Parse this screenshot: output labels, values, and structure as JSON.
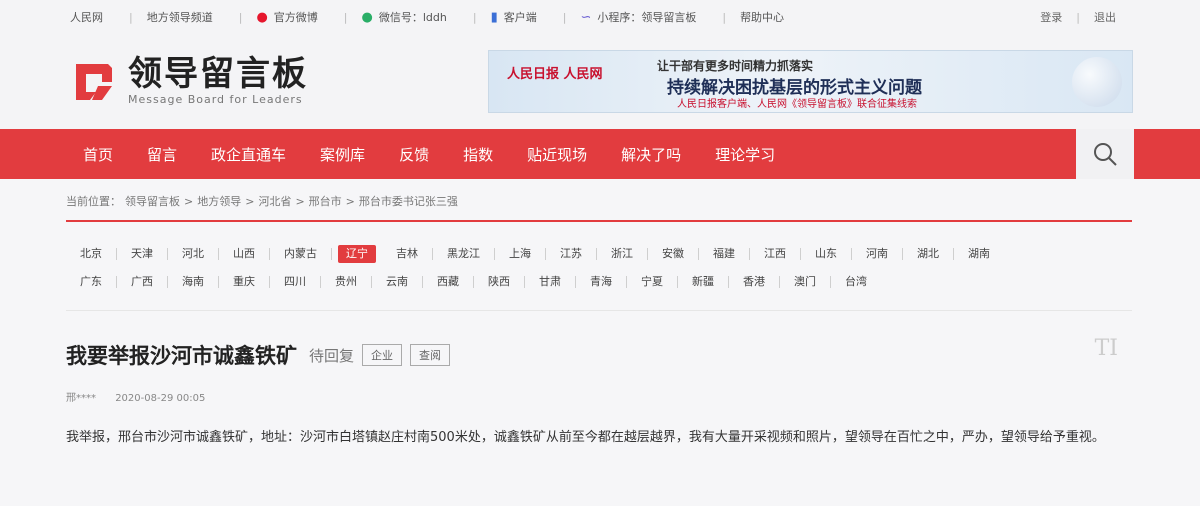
{
  "topbar": {
    "links": [
      {
        "label": "人民网",
        "icon": ""
      },
      {
        "label": "地方领导频道",
        "icon": ""
      },
      {
        "label": "官方微博",
        "icon": "weibo-icon"
      },
      {
        "label": "微信号：lddh",
        "icon": "wechat-icon"
      },
      {
        "label": "客户端",
        "icon": "phone-icon"
      },
      {
        "label": "小程序：领导留言板",
        "icon": "miniprogram-icon"
      },
      {
        "label": "帮助中心",
        "icon": ""
      }
    ],
    "login": "登录",
    "logout": "退出"
  },
  "logo": {
    "cn": "领导留言板",
    "en": "Message Board for Leaders"
  },
  "banner": {
    "publisher": "人民日报 人民网",
    "line1": "让干部有更多时间精力抓落实",
    "line2": "持续解决困扰基层的形式主义问题",
    "line3": "人民日报客户端、人民网《领导留言板》联合征集线索"
  },
  "nav": [
    "首页",
    "留言",
    "政企直通车",
    "案例库",
    "反馈",
    "指数",
    "贴近现场",
    "解决了吗",
    "理论学习"
  ],
  "breadcrumb": {
    "prefix": "当前位置：",
    "items": [
      "领导留言板",
      "地方领导",
      "河北省",
      "邢台市",
      "邢台市委书记张三强"
    ]
  },
  "regions": {
    "row1": [
      "北京",
      "天津",
      "河北",
      "山西",
      "内蒙古",
      "辽宁",
      "吉林",
      "黑龙江",
      "上海",
      "江苏",
      "浙江",
      "安徽",
      "福建",
      "江西",
      "山东",
      "河南",
      "湖北",
      "湖南"
    ],
    "row2": [
      "广东",
      "广西",
      "海南",
      "重庆",
      "四川",
      "贵州",
      "云南",
      "西藏",
      "陕西",
      "甘肃",
      "青海",
      "宁夏",
      "新疆",
      "香港",
      "澳门",
      "台湾"
    ],
    "active": "辽宁"
  },
  "post": {
    "title": "我要举报沙河市诚鑫铁矿",
    "status": "待回复",
    "tags": [
      "企业",
      "查阅"
    ],
    "author": "邢****",
    "time": "2020-08-29 00:05",
    "body": "我举报，邢台市沙河市诚鑫铁矿，地址：沙河市白塔镇赵庄村南500米处，诚鑫铁矿从前至今都在越层越界，我有大量开采视频和照片，望领导在百忙之中，严办，望领导给予重视。"
  },
  "colors": {
    "brand_red": "#e23c3f"
  }
}
